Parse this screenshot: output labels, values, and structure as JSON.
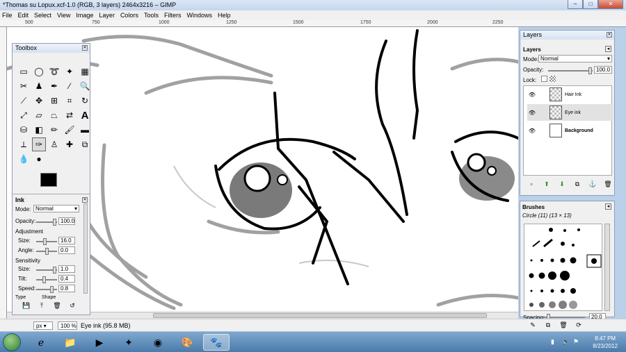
{
  "window": {
    "title": "*Thomas su Lopux.xcf-1.0 (RGB, 3 layers) 2464x3216 – GIMP"
  },
  "menu": [
    "File",
    "Edit",
    "Select",
    "View",
    "Image",
    "Layer",
    "Colors",
    "Tools",
    "Filters",
    "Windows",
    "Help"
  ],
  "ruler_labels": [
    "500",
    "750",
    "1000",
    "1250",
    "1500",
    "1750",
    "2000",
    "2250"
  ],
  "toolbox": {
    "title": "Toolbox",
    "tools": [
      "rect-select",
      "ellipse-select",
      "free-select",
      "fuzzy-select",
      "select-by-color",
      "scissors",
      "foreground-select",
      "paths",
      "color-picker",
      "zoom",
      "measure",
      "move",
      "align",
      "crop",
      "rotate",
      "scale",
      "shear",
      "perspective",
      "flip",
      "text",
      "bucket-fill",
      "blend",
      "pencil",
      "paintbrush",
      "eraser",
      "airbrush",
      "ink",
      "clone",
      "heal",
      "perspective-clone",
      "smudge",
      "dodge-burn"
    ],
    "fg_color": "#000000",
    "bg_color": "#ffffff"
  },
  "tool_options": {
    "title": "Ink",
    "mode_label": "Mode:",
    "mode_value": "Normal",
    "opacity_label": "Opacity:",
    "opacity_value": "100.0",
    "adjustment_label": "Adjustment",
    "size_label": "Size:",
    "size_value": "16.0",
    "angle_label": "Angle:",
    "angle_value": "0.0",
    "sensitivity_label": "Sensitivity",
    "sens_size_label": "Size:",
    "sens_size_value": "1.0",
    "tilt_label": "Tilt:",
    "tilt_value": "0.4",
    "speed_label": "Speed:",
    "speed_value": "0.8",
    "type_label": "Type",
    "shape_label": "Shape"
  },
  "layers_panel": {
    "window_title": "Layers",
    "tab_title": "Layers",
    "mode_label": "Mode:",
    "mode_value": "Normal",
    "opacity_label": "Opacity:",
    "opacity_value": "100.0",
    "lock_label": "Lock:",
    "layers": [
      {
        "name": "Hair Ink",
        "selected": false
      },
      {
        "name": "Eye ink",
        "selected": true
      },
      {
        "name": "Background",
        "selected": false
      }
    ]
  },
  "brushes_panel": {
    "title": "Brushes",
    "current": "Circle (11) (13 × 13)",
    "spacing_label": "Spacing:",
    "spacing_value": "20.0"
  },
  "status": {
    "unit": "px",
    "zoom": "100 %",
    "message": "Eye ink (95.8 MB)"
  },
  "taskbar": {
    "time": "8:47 PM",
    "date": "8/23/2012"
  }
}
